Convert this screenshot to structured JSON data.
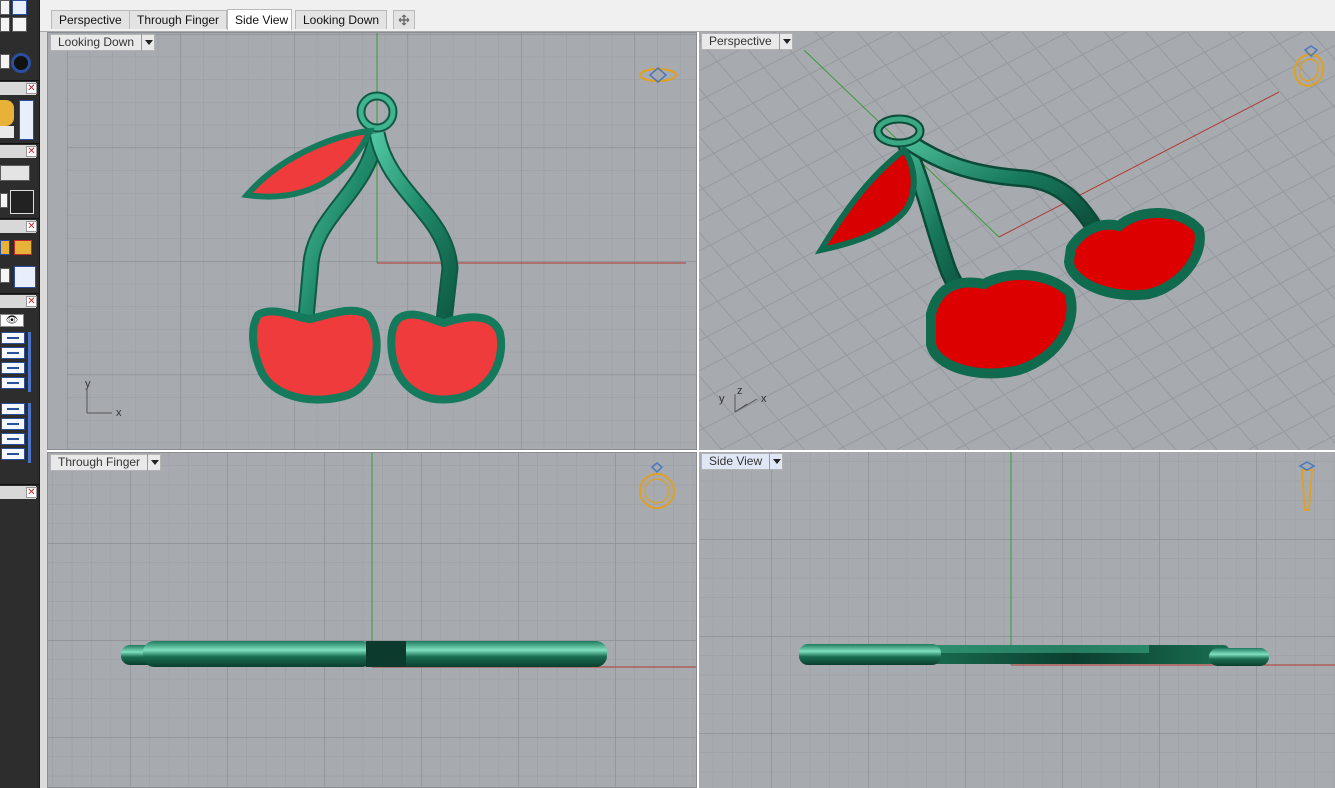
{
  "tabs": [
    {
      "label": "Perspective",
      "active": false
    },
    {
      "label": "Through Finger",
      "active": false
    },
    {
      "label": "Side View",
      "active": true
    },
    {
      "label": "Looking Down",
      "active": false
    }
  ],
  "tab_add_icon": "plus-icon",
  "viewports": {
    "top_left": {
      "label": "Looking Down",
      "axis_x": "x",
      "axis_y": "y",
      "nav_icon": "ring-top-view-icon"
    },
    "top_right": {
      "label": "Perspective",
      "axis_x": "x",
      "axis_y": "y",
      "axis_z": "z",
      "nav_icon": "ring-perspective-icon"
    },
    "bottom_left": {
      "label": "Through Finger",
      "nav_icon": "ring-front-view-icon"
    },
    "bottom_right": {
      "label": "Side View",
      "active": true,
      "nav_icon": "ring-side-view-icon"
    }
  },
  "colors": {
    "viewport_bg": "#a7abb0",
    "grid_minor": "#9a9ea3",
    "grid_major": "#8a8e93",
    "x_axis": "#b03a2e",
    "y_axis": "#3b9a3b",
    "model_metal": "#1f8a6a",
    "model_enamel": "#ef3b3b",
    "nav_icon": "#e0a020"
  },
  "model": {
    "name": "cherry-pendant"
  }
}
